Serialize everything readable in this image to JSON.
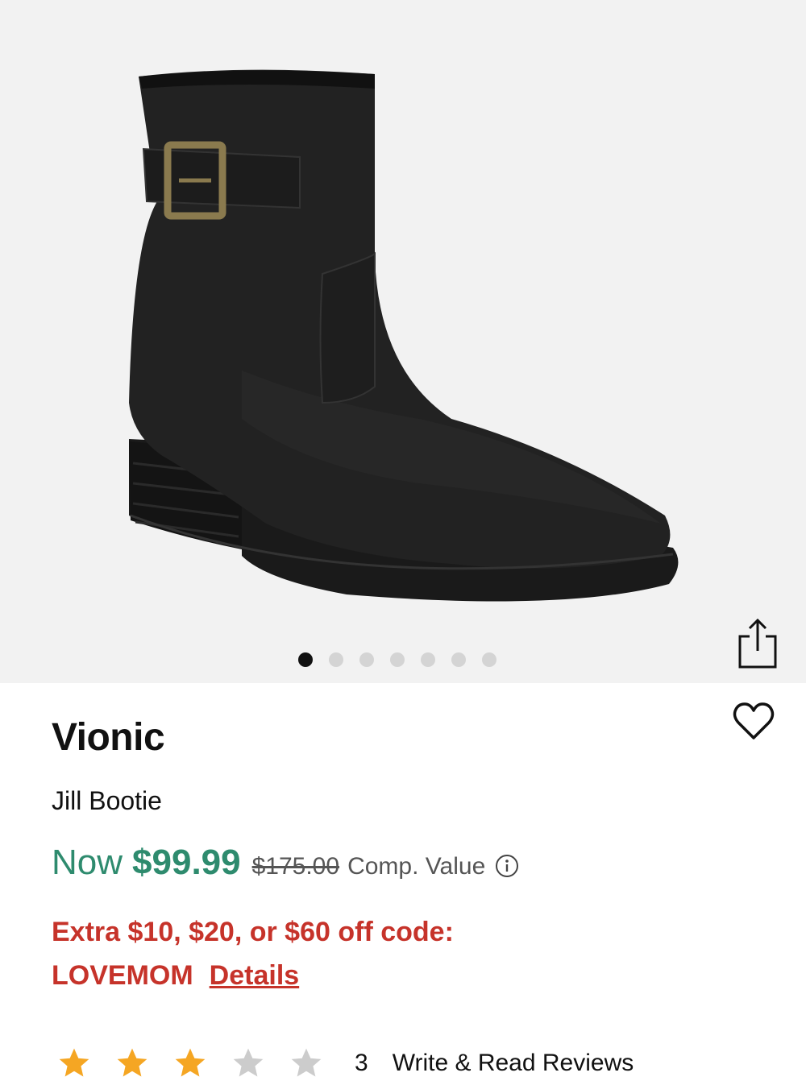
{
  "product": {
    "brand": "Vionic",
    "name": "Jill Bootie",
    "image_alt": "black-ankle-boot-with-buckle",
    "carousel": {
      "total": 7,
      "active_index": 0
    }
  },
  "pricing": {
    "now_label": "Now",
    "now_price": "$99.99",
    "original_price": "$175.00",
    "comp_label": "Comp. Value",
    "price_color": "#2e8b6e"
  },
  "promo": {
    "line1": "Extra $10, $20, or $60 off code:",
    "code": "LOVEMOM",
    "details_label": "Details",
    "color": "#c6332a"
  },
  "reviews": {
    "rating": 3,
    "max": 5,
    "count": "3",
    "link_label": "Write & Read Reviews",
    "star_color": "#f5a623"
  },
  "icons": {
    "share": "share-icon",
    "wishlist": "heart-icon",
    "info": "info-icon"
  }
}
